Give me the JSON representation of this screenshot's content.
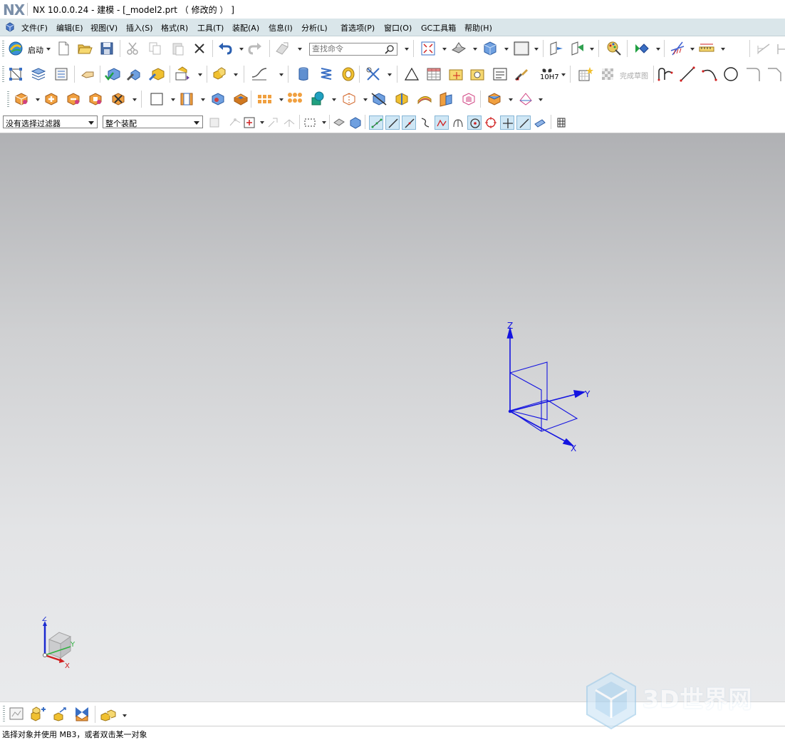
{
  "window": {
    "logo": "NX",
    "title": "NX 10.0.0.24 - 建模 - [_model2.prt （ 修改的 ） ]"
  },
  "menu": {
    "items": [
      "文件(F)",
      "编辑(E)",
      "视图(V)",
      "插入(S)",
      "格式(R)",
      "工具(T)",
      "装配(A)",
      "信息(I)",
      "分析(L)",
      "首选项(P)",
      "窗口(O)",
      "GC工具箱",
      "帮助(H)"
    ]
  },
  "toolbar": {
    "start_label": "启动",
    "search_placeholder": "查找命令",
    "finish_sketch_label": "完成草图",
    "fit_label": "10H7"
  },
  "selection_bar": {
    "filter_value": "没有选择过滤器",
    "scope_value": "整个装配"
  },
  "viewport": {
    "datum_csys": {
      "x_label": "X",
      "y_label": "Y",
      "z_label": "Z"
    },
    "view_triad": {
      "x_label": "X",
      "y_label": "Y",
      "z_label": "Z"
    },
    "datum_color": "#1414e0",
    "background_top": "#b0b1b4",
    "background_bottom": "#e9eaec"
  },
  "status": {
    "message": "选择对象并使用 MB3，或者双击某一对象"
  },
  "watermark": {
    "text": "3D世界网"
  },
  "icons": [
    "start-icon",
    "new-icon",
    "open-icon",
    "save-icon",
    "cut-icon",
    "copy-icon",
    "paste-icon",
    "delete-icon",
    "undo-icon",
    "redo-icon",
    "repeat-command-icon",
    "search-icon",
    "fit-icon",
    "view-orient-icon",
    "render-style-icon",
    "background-icon",
    "layer-icon",
    "edit-object-display-icon",
    "sketch-icon",
    "point-icon",
    "line-icon",
    "arc-icon",
    "circle-icon",
    "fillet-icon",
    "chamfer-icon"
  ]
}
